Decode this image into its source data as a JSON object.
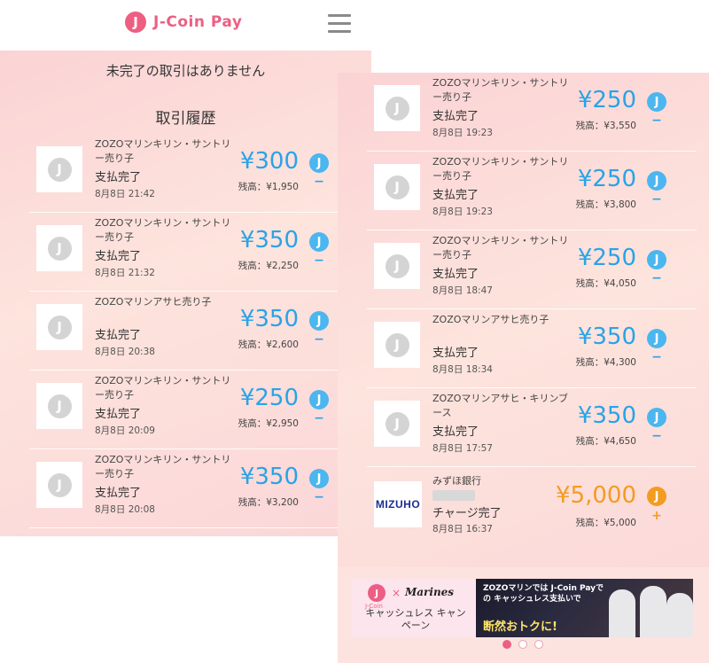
{
  "app": {
    "name": "J-Coin Pay",
    "logo_mark": "J",
    "menu_icon": "hamburger-menu-icon",
    "accent_color": "#ec5f83"
  },
  "left_screen": {
    "pending_notice": "未完了の取引はありません",
    "history_title": "取引履歴",
    "transactions": [
      {
        "merchant": "ZOZOマリンキリン・サントリー売り子",
        "status": "支払完了",
        "datetime": "8月8日 21:42",
        "amount": "¥300",
        "balance": "残高：¥1,950",
        "sign": "−",
        "coin": "J"
      },
      {
        "merchant": "ZOZOマリンキリン・サントリー売り子",
        "status": "支払完了",
        "datetime": "8月8日 21:32",
        "amount": "¥350",
        "balance": "残高：¥2,250",
        "sign": "−",
        "coin": "J"
      },
      {
        "merchant": "ZOZOマリンアサヒ売り子",
        "status": "支払完了",
        "datetime": "8月8日 20:38",
        "amount": "¥350",
        "balance": "残高：¥2,600",
        "sign": "−",
        "coin": "J"
      },
      {
        "merchant": "ZOZOマリンキリン・サントリー売り子",
        "status": "支払完了",
        "datetime": "8月8日 20:09",
        "amount": "¥250",
        "balance": "残高：¥2,950",
        "sign": "−",
        "coin": "J"
      },
      {
        "merchant": "ZOZOマリンキリン・サントリー売り子",
        "status": "支払完了",
        "datetime": "8月8日 20:08",
        "amount": "¥350",
        "balance": "残高：¥3,200",
        "sign": "−",
        "coin": "J"
      }
    ]
  },
  "right_screen": {
    "transactions": [
      {
        "merchant": "ZOZOマリンキリン・サントリー売り子",
        "status": "支払完了",
        "datetime": "8月8日 19:23",
        "amount": "¥250",
        "balance": "残高：¥3,550",
        "sign": "−",
        "coin": "J"
      },
      {
        "merchant": "ZOZOマリンキリン・サントリー売り子",
        "status": "支払完了",
        "datetime": "8月8日 19:23",
        "amount": "¥250",
        "balance": "残高：¥3,800",
        "sign": "−",
        "coin": "J"
      },
      {
        "merchant": "ZOZOマリンキリン・サントリー売り子",
        "status": "支払完了",
        "datetime": "8月8日 18:47",
        "amount": "¥250",
        "balance": "残高：¥4,050",
        "sign": "−",
        "coin": "J"
      },
      {
        "merchant": "ZOZOマリンアサヒ売り子",
        "status": "支払完了",
        "datetime": "8月8日 18:34",
        "amount": "¥350",
        "balance": "残高：¥4,300",
        "sign": "−",
        "coin": "J"
      },
      {
        "merchant": "ZOZOマリンアサヒ・キリンブース",
        "status": "支払完了",
        "datetime": "8月8日 17:57",
        "amount": "¥350",
        "balance": "残高：¥4,650",
        "sign": "−",
        "coin": "J"
      }
    ],
    "charge": {
      "bank": "みずほ銀行",
      "bank_logo": "MIZUHO",
      "status": "チャージ完了",
      "datetime": "8月8日 16:37",
      "amount": "¥5,000",
      "balance": "残高：¥5,000",
      "sign": "+",
      "coin": "J",
      "color": "#f39c22"
    },
    "banner": {
      "jcoin_mark": "J",
      "jcoin_label": "J-Coin",
      "cross": "×",
      "partner": "Marines",
      "campaign": "キャッシュレス キャンペーン",
      "headline": "ZOZOマリンでは J-Coin Payでの キャッシュレス支払いで",
      "tagline": "断然おトクに!"
    },
    "carousel": {
      "count": 3,
      "active": 0
    }
  },
  "colors": {
    "amount": "#29a3e8",
    "coin": "#4bb6ef",
    "charge": "#f39c22"
  }
}
